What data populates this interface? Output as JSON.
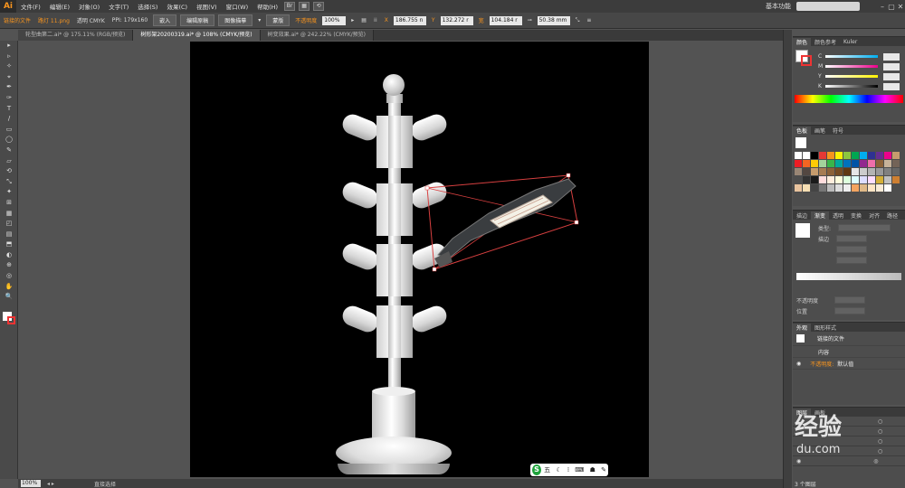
{
  "app": {
    "logo": "Ai",
    "workspace": "基本功能"
  },
  "menu": [
    "文件(F)",
    "编辑(E)",
    "对象(O)",
    "文字(T)",
    "选择(S)",
    "效果(C)",
    "视图(V)",
    "窗口(W)",
    "帮助(H)"
  ],
  "control": {
    "linked_file": "链接的文件",
    "file_name": "路灯 11.png",
    "mode": "透明 CMYK",
    "ppi": "PPI: 179x160",
    "embed": "嵌入",
    "edit_original": "编辑原稿",
    "image_trace": "图像描摹",
    "mask": "蒙版",
    "opacity_label": "不透明度",
    "opacity_value": "100%",
    "x_label": "X",
    "x_value": "186.755 n",
    "y_label": "Y",
    "y_value": "132.272 r",
    "w_label": "宽",
    "w_value": "104.184 r",
    "h_value": "50.38 mm"
  },
  "tabs": [
    "轮型曲第二.ai* @ 175.11% (RGB/预览)",
    "树形架20200319.ai* @ 108% (CMYK/预览)",
    "树变效果.ai* @ 242.22% (CMYK/预览)"
  ],
  "tools": [
    "▸",
    "▹",
    "✧",
    "⌖",
    "✒",
    "✑",
    "T",
    "/",
    "▭",
    "◯",
    "✎",
    "▱",
    "⟲",
    "⤡",
    "✦",
    "⊞",
    "▦",
    "◰",
    "▤",
    "⬒",
    "◐",
    "⊕",
    "◎",
    "✋",
    "🔍"
  ],
  "panels": {
    "color": {
      "tabs": [
        "颜色",
        "颜色参考",
        "Kuler"
      ],
      "channels": [
        "C",
        "M",
        "Y",
        "K"
      ]
    },
    "swatches": {
      "tabs": [
        "色板",
        "画笔",
        "符号"
      ]
    },
    "stroke": {
      "tabs": [
        "描边",
        "渐变",
        "透明",
        "变换",
        "对齐",
        "路径"
      ],
      "type_label": "类型:",
      "stroke_label": "描边",
      "angle_label": "不透明度",
      "position_label": "位置"
    },
    "appearance": {
      "tabs": [
        "外观",
        "图形样式"
      ],
      "item_title": "链接的文件",
      "content": "内容",
      "opacity": "不透明度:",
      "opacity_value": "默认值"
    },
    "layers": {
      "tabs": [
        "图层",
        "画板"
      ],
      "count": "3 个图层"
    }
  },
  "status": {
    "zoom": "100%",
    "mode": "直接选择"
  },
  "sogou": {
    "logo": "S",
    "text": "五 ☾ ⁞ ⌨ ☗ ✎"
  },
  "watermark": {
    "line1": "经验",
    "line2": "du.com"
  },
  "colors": {
    "accent": "#f7941e",
    "bg": "#535353",
    "selection": "#e03c3c"
  }
}
